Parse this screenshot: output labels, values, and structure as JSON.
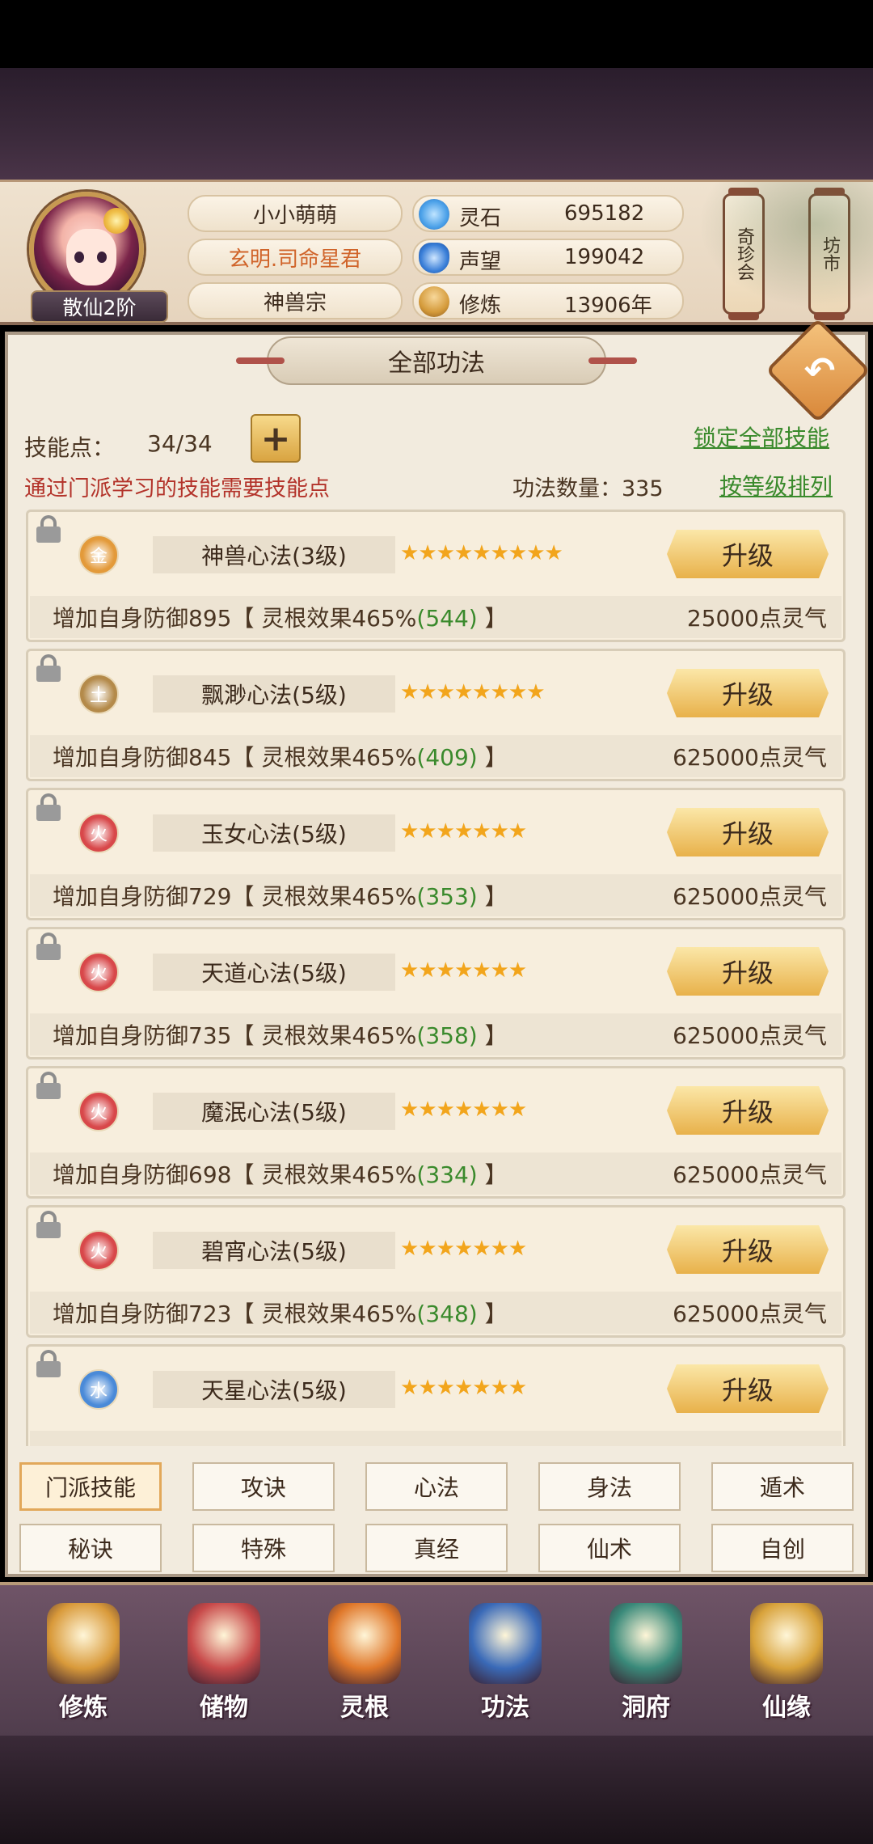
{
  "player": {
    "name": "小小萌萌",
    "title": "玄明.司命星君",
    "sect": "神兽宗",
    "rank": "散仙2阶"
  },
  "stats": [
    {
      "label": "灵石",
      "value": "695182",
      "icon": "spirit-stone-icon",
      "color": "#4aa0e8"
    },
    {
      "label": "声望",
      "value": "199042",
      "icon": "reputation-crystal-icon",
      "color": "#3a7fd8"
    },
    {
      "label": "修炼",
      "value": "13906年",
      "icon": "meditation-icon",
      "color": "#d49a3a"
    }
  ],
  "side_tabs": [
    {
      "label": "奇珍会"
    },
    {
      "label": "坊市"
    }
  ],
  "panel": {
    "title": "全部功法",
    "skill_points_label": "技能点：",
    "skill_points_value": "34/34",
    "note": "通过门派学习的技能需要技能点",
    "lock_all": "锁定全部技能",
    "count_label": "功法数量：335",
    "sort_by_level": "按等级排列"
  },
  "skills": [
    {
      "element": "金",
      "elem_color": "#e39a3a",
      "name": "神兽心法(3级)",
      "stars": 9,
      "button": "升级",
      "desc_prefix": "增加自身防御895【 灵根效果465%",
      "desc_bonus": "(544)",
      "desc_suffix": " 】",
      "cost": "25000点灵气"
    },
    {
      "element": "土",
      "elem_color": "#b48a4a",
      "name": "飘渺心法(5级)",
      "stars": 8,
      "button": "升级",
      "desc_prefix": "增加自身防御845【 灵根效果465%",
      "desc_bonus": "(409)",
      "desc_suffix": " 】",
      "cost": "625000点灵气"
    },
    {
      "element": "火",
      "elem_color": "#d8484a",
      "name": "玉女心法(5级)",
      "stars": 7,
      "button": "升级",
      "desc_prefix": "增加自身防御729【 灵根效果465%",
      "desc_bonus": "(353)",
      "desc_suffix": " 】",
      "cost": "625000点灵气"
    },
    {
      "element": "火",
      "elem_color": "#d8484a",
      "name": "天道心法(5级)",
      "stars": 7,
      "button": "升级",
      "desc_prefix": "增加自身防御735【 灵根效果465%",
      "desc_bonus": "(358)",
      "desc_suffix": " 】",
      "cost": "625000点灵气"
    },
    {
      "element": "火",
      "elem_color": "#d8484a",
      "name": "魔泯心法(5级)",
      "stars": 7,
      "button": "升级",
      "desc_prefix": "增加自身防御698【 灵根效果465%",
      "desc_bonus": "(334)",
      "desc_suffix": " 】",
      "cost": "625000点灵气"
    },
    {
      "element": "火",
      "elem_color": "#d8484a",
      "name": "碧宵心法(5级)",
      "stars": 7,
      "button": "升级",
      "desc_prefix": "增加自身防御723【 灵根效果465%",
      "desc_bonus": "(348)",
      "desc_suffix": " 】",
      "cost": "625000点灵气"
    },
    {
      "element": "水",
      "elem_color": "#4a8ad8",
      "name": "天星心法(5级)",
      "stars": 7,
      "button": "升级",
      "desc_prefix": "",
      "desc_bonus": "",
      "desc_suffix": "",
      "cost": ""
    }
  ],
  "category_tabs": [
    {
      "label": "门派技能",
      "active": true
    },
    {
      "label": "攻诀",
      "active": false
    },
    {
      "label": "心法",
      "active": false
    },
    {
      "label": "身法",
      "active": false
    },
    {
      "label": "遁术",
      "active": false
    },
    {
      "label": "秘诀",
      "active": false
    },
    {
      "label": "特殊",
      "active": false
    },
    {
      "label": "真经",
      "active": false
    },
    {
      "label": "仙术",
      "active": false
    },
    {
      "label": "自创",
      "active": false
    }
  ],
  "nav": [
    {
      "label": "修炼",
      "icon": "cultivate-icon",
      "color": "#d99a3a"
    },
    {
      "label": "储物",
      "icon": "storage-bag-icon",
      "color": "#c84a4a"
    },
    {
      "label": "灵根",
      "icon": "spirit-root-icon",
      "color": "#e0782a"
    },
    {
      "label": "功法",
      "icon": "skill-book-icon",
      "color": "#3a6ab8"
    },
    {
      "label": "洞府",
      "icon": "cave-mansion-icon",
      "color": "#3a8a7a"
    },
    {
      "label": "仙缘",
      "icon": "immortal-fate-icon",
      "color": "#d8a23a"
    }
  ]
}
